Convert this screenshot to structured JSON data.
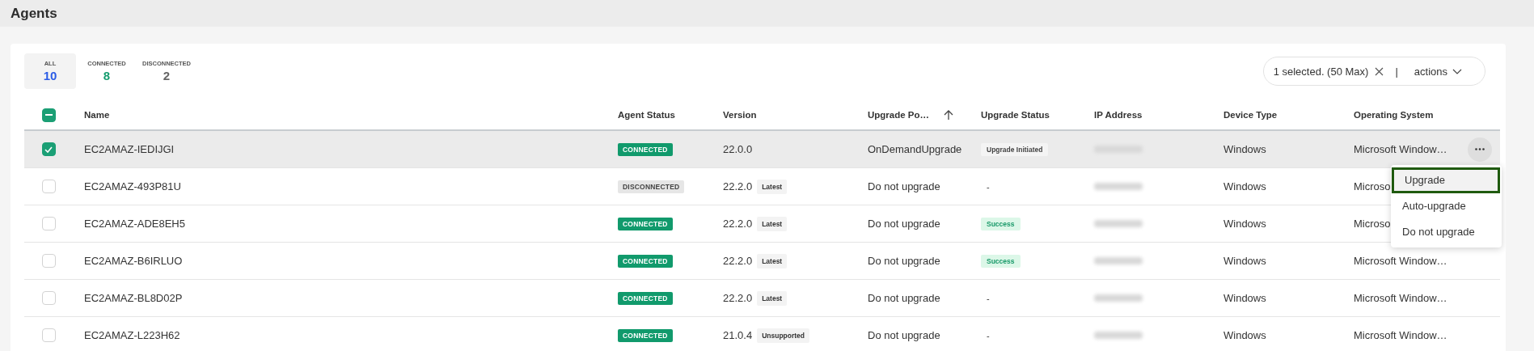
{
  "page_title": "Agents",
  "tabs": [
    {
      "label": "ALL",
      "count": "10",
      "selected": true,
      "kind": "all"
    },
    {
      "label": "CONNECTED",
      "count": "8",
      "selected": false,
      "kind": "connected"
    },
    {
      "label": "DISCONNECTED",
      "count": "2",
      "selected": false,
      "kind": "disconnected"
    }
  ],
  "selection_bar": {
    "text": "1 selected. (50 Max)",
    "separator": "|",
    "actions_label": "actions"
  },
  "table": {
    "header_checkbox": {
      "partial": true
    },
    "columns": [
      {
        "label": "Name"
      },
      {
        "label": "Agent Status"
      },
      {
        "label": "Version"
      },
      {
        "label": "Upgrade Po…",
        "sorted_ascending": true
      },
      {
        "label": "Upgrade Status"
      },
      {
        "label": "IP Address"
      },
      {
        "label": "Device Type"
      },
      {
        "label": "Operating System"
      }
    ],
    "rows": [
      {
        "checked": true,
        "name": "EC2AMAZ-IEDIJGI",
        "status": {
          "label": "CONNECTED",
          "kind": "connected"
        },
        "version": "22.0.0",
        "upgrade_policy": "OnDemandUpgrade",
        "upgrade_status": {
          "label": "Upgrade Initiated",
          "kind": "initiated"
        },
        "device_type": "Windows",
        "os": "Microsoft Window…",
        "menu_open": true
      },
      {
        "checked": false,
        "name": "EC2AMAZ-493P81U",
        "status": {
          "label": "DISCONNECTED",
          "kind": "disconnected"
        },
        "version": "22.2.0",
        "version_tag": "Latest",
        "upgrade_policy": "Do not upgrade",
        "upgrade_status": {
          "label": "-",
          "kind": "none"
        },
        "device_type": "Windows",
        "os": "Microso"
      },
      {
        "checked": false,
        "name": "EC2AMAZ-ADE8EH5",
        "status": {
          "label": "CONNECTED",
          "kind": "connected"
        },
        "version": "22.2.0",
        "version_tag": "Latest",
        "upgrade_policy": "Do not upgrade",
        "upgrade_status": {
          "label": "Success",
          "kind": "success"
        },
        "device_type": "Windows",
        "os": "Microso"
      },
      {
        "checked": false,
        "name": "EC2AMAZ-B6IRLUO",
        "status": {
          "label": "CONNECTED",
          "kind": "connected"
        },
        "version": "22.2.0",
        "version_tag": "Latest",
        "upgrade_policy": "Do not upgrade",
        "upgrade_status": {
          "label": "Success",
          "kind": "success"
        },
        "device_type": "Windows",
        "os": "Microsoft Window…"
      },
      {
        "checked": false,
        "name": "EC2AMAZ-BL8D02P",
        "status": {
          "label": "CONNECTED",
          "kind": "connected"
        },
        "version": "22.2.0",
        "version_tag": "Latest",
        "upgrade_policy": "Do not upgrade",
        "upgrade_status": {
          "label": "-",
          "kind": "none"
        },
        "device_type": "Windows",
        "os": "Microsoft Window…"
      },
      {
        "checked": false,
        "name": "EC2AMAZ-L223H62",
        "status": {
          "label": "CONNECTED",
          "kind": "connected"
        },
        "version": "21.0.4",
        "version_tag": "Unsupported",
        "upgrade_policy": "Do not upgrade",
        "upgrade_status": {
          "label": "-",
          "kind": "none"
        },
        "device_type": "Windows",
        "os": "Microsoft Window…"
      }
    ]
  },
  "row_menu": [
    {
      "label": "Upgrade",
      "selected": true
    },
    {
      "label": "Auto-upgrade",
      "selected": false
    },
    {
      "label": "Do not upgrade",
      "selected": false
    }
  ]
}
